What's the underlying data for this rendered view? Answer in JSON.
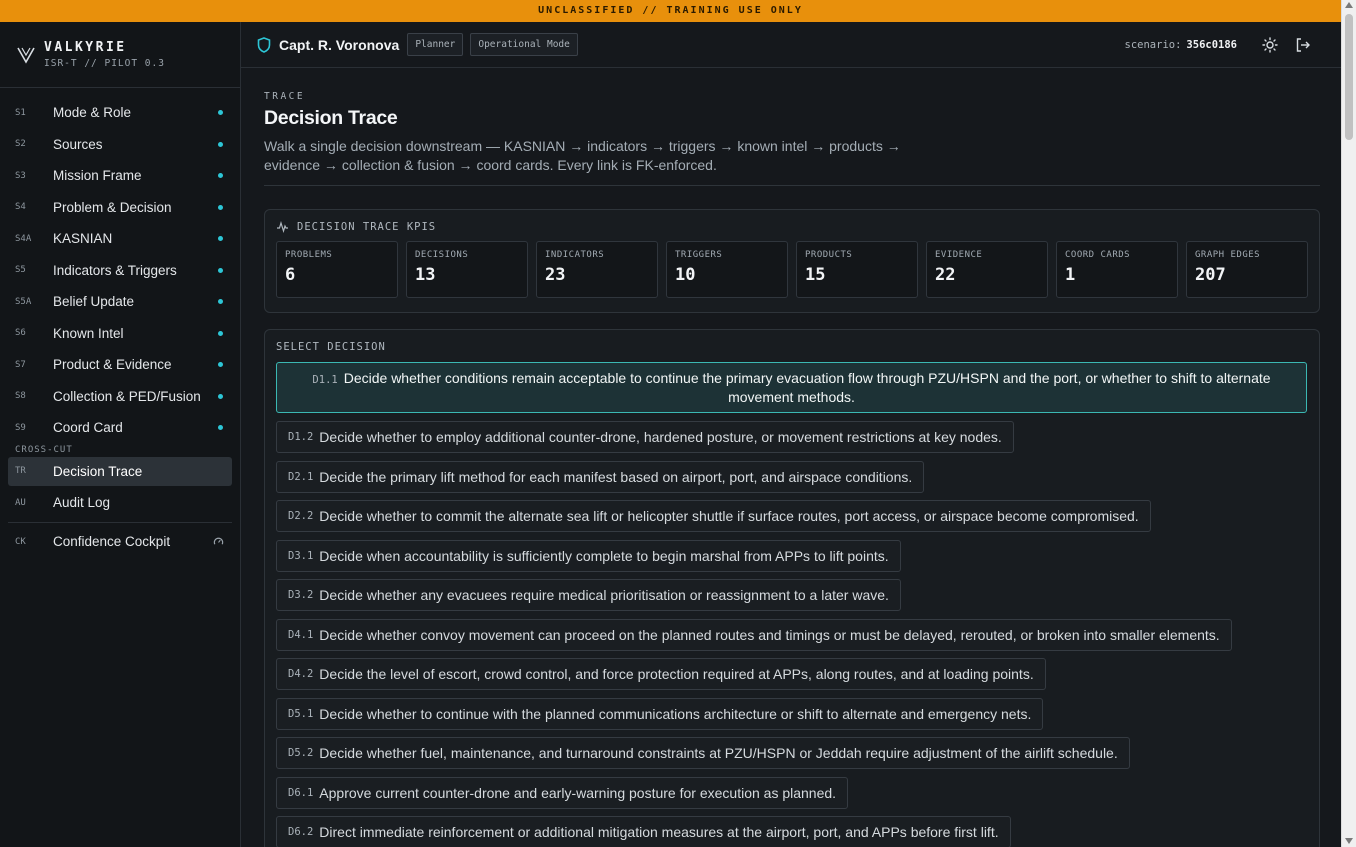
{
  "banner": "UNCLASSIFIED // TRAINING USE ONLY",
  "brand": {
    "name": "VALKYRIE",
    "subtitle": "ISR-T // PILOT 0.3"
  },
  "nav": {
    "items": [
      {
        "code": "S1",
        "label": "Mode & Role"
      },
      {
        "code": "S2",
        "label": "Sources"
      },
      {
        "code": "S3",
        "label": "Mission Frame"
      },
      {
        "code": "S4",
        "label": "Problem & Decision"
      },
      {
        "code": "S4A",
        "label": "KASNIAN"
      },
      {
        "code": "S5",
        "label": "Indicators & Triggers"
      },
      {
        "code": "S5A",
        "label": "Belief Update"
      },
      {
        "code": "S6",
        "label": "Known Intel"
      },
      {
        "code": "S7",
        "label": "Product & Evidence"
      },
      {
        "code": "S8",
        "label": "Collection & PED/Fusion"
      },
      {
        "code": "S9",
        "label": "Coord Card"
      }
    ],
    "section_label": "CROSS-CUT",
    "cross_cut": [
      {
        "code": "TR",
        "label": "Decision Trace",
        "active": true
      },
      {
        "code": "AU",
        "label": "Audit Log"
      }
    ],
    "cockpit": {
      "code": "CK",
      "label": "Confidence Cockpit"
    }
  },
  "header": {
    "user": "Capt. R. Voronova",
    "role_chip": "Planner",
    "mode_chip": "Operational Mode",
    "scenario_label": "scenario:",
    "scenario_id": "356c0186"
  },
  "page": {
    "eyebrow": "TRACE",
    "title": "Decision Trace",
    "description": "Walk a single decision downstream — KASNIAN → indicators → triggers → known intel → products → evidence → collection & fusion → coord cards. Every link is FK-enforced."
  },
  "kpi_panel": {
    "title": "DECISION TRACE KPIS",
    "kpis": [
      {
        "label": "PROBLEMS",
        "value": "6"
      },
      {
        "label": "DECISIONS",
        "value": "13"
      },
      {
        "label": "INDICATORS",
        "value": "23"
      },
      {
        "label": "TRIGGERS",
        "value": "10"
      },
      {
        "label": "PRODUCTS",
        "value": "15"
      },
      {
        "label": "EVIDENCE",
        "value": "22"
      },
      {
        "label": "COORD CARDS",
        "value": "1"
      },
      {
        "label": "GRAPH EDGES",
        "value": "207"
      }
    ]
  },
  "decision_panel": {
    "title": "SELECT DECISION",
    "selected": "D1.1",
    "decisions": [
      {
        "code": "D1.1",
        "text": "Decide whether conditions remain acceptable to continue the primary evacuation flow through PZU/HSPN and the port, or whether to shift to alternate movement methods."
      },
      {
        "code": "D1.2",
        "text": "Decide whether to employ additional counter-drone, hardened posture, or movement restrictions at key nodes."
      },
      {
        "code": "D2.1",
        "text": "Decide the primary lift method for each manifest based on airport, port, and airspace conditions."
      },
      {
        "code": "D2.2",
        "text": "Decide whether to commit the alternate sea lift or helicopter shuttle if surface routes, port access, or airspace become compromised."
      },
      {
        "code": "D3.1",
        "text": "Decide when accountability is sufficiently complete to begin marshal from APPs to lift points."
      },
      {
        "code": "D3.2",
        "text": "Decide whether any evacuees require medical prioritisation or reassignment to a later wave."
      },
      {
        "code": "D4.1",
        "text": "Decide whether convoy movement can proceed on the planned routes and timings or must be delayed, rerouted, or broken into smaller elements."
      },
      {
        "code": "D4.2",
        "text": "Decide the level of escort, crowd control, and force protection required at APPs, along routes, and at loading points."
      },
      {
        "code": "D5.1",
        "text": "Decide whether to continue with the planned communications architecture or shift to alternate and emergency nets."
      },
      {
        "code": "D5.2",
        "text": "Decide whether fuel, maintenance, and turnaround constraints at PZU/HSPN or Jeddah require adjustment of the airlift schedule."
      },
      {
        "code": "D6.1",
        "text": "Approve current counter-drone and early-warning posture for execution as planned."
      },
      {
        "code": "D6.2",
        "text": "Direct immediate reinforcement or additional mitigation measures at the airport, port, and APPs before first lift."
      }
    ]
  },
  "colors": {
    "accent": "#2dc6d6",
    "banner": "#e8900c",
    "selected_border": "#3bb8b3"
  },
  "icons": [
    "valkyrie-logo-icon",
    "shield-icon",
    "sun-icon",
    "logout-icon",
    "pulse-icon",
    "gauge-icon"
  ]
}
